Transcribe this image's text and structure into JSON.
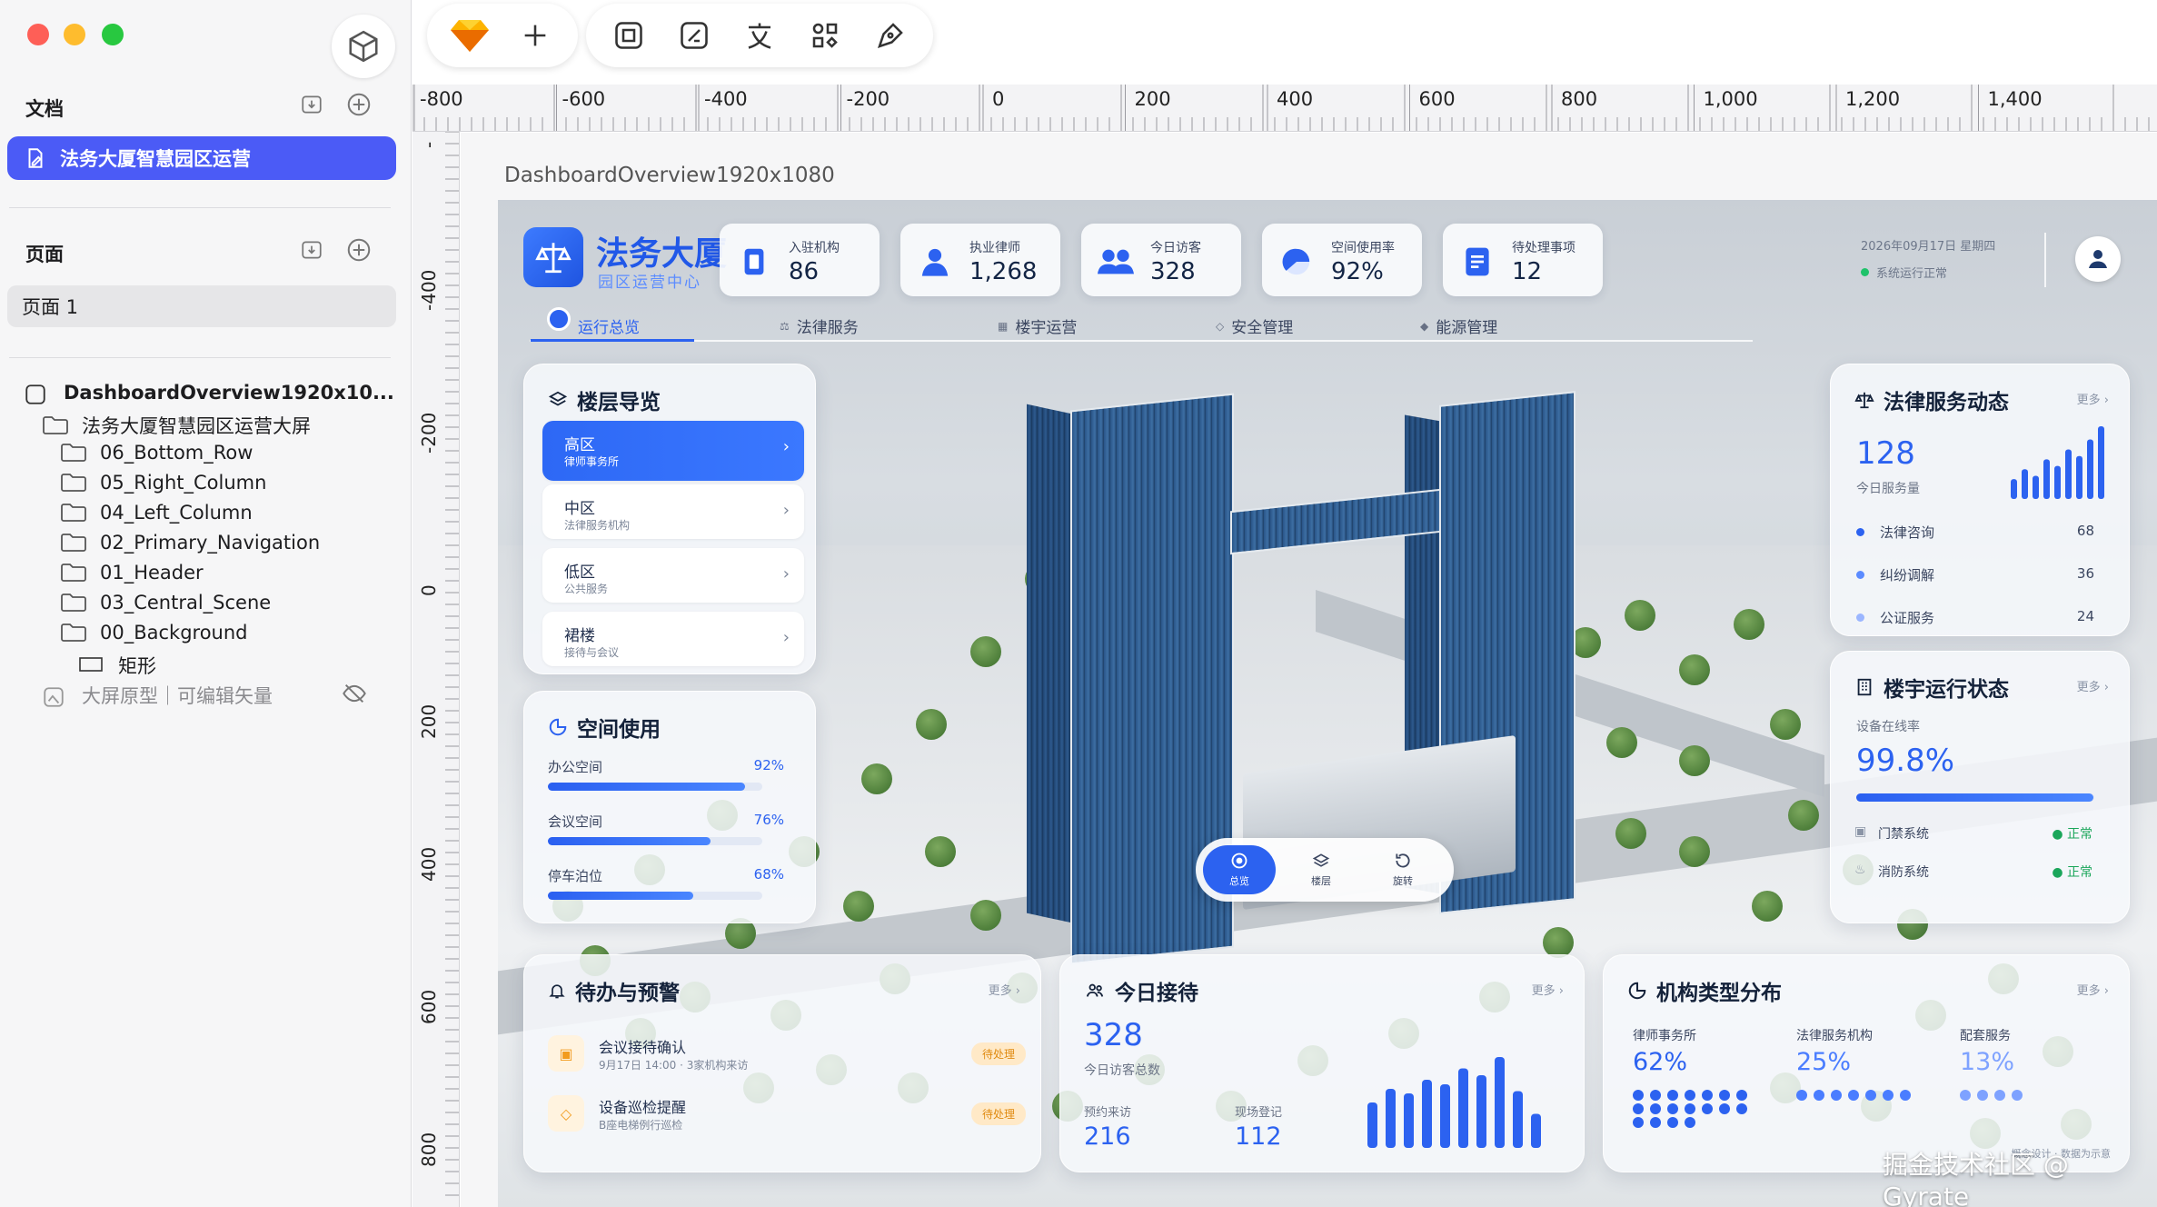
{
  "sidebar": {
    "docs_heading": "文档",
    "doc_name": "法务大厦智慧园区运营",
    "pages_heading": "页面",
    "page_name": "页面 1",
    "layers": [
      {
        "name": "DashboardOverview1920x10...",
        "kind": "frame",
        "indent": 0
      },
      {
        "name": "法务大厦智慧园区运营大屏",
        "kind": "folder",
        "indent": 1
      },
      {
        "name": "06_Bottom_Row",
        "kind": "folder",
        "indent": 2
      },
      {
        "name": "05_Right_Column",
        "kind": "folder",
        "indent": 2
      },
      {
        "name": "04_Left_Column",
        "kind": "folder",
        "indent": 2
      },
      {
        "name": "02_Primary_Navigation",
        "kind": "folder",
        "indent": 2
      },
      {
        "name": "01_Header",
        "kind": "folder",
        "indent": 2
      },
      {
        "name": "03_Central_Scene",
        "kind": "folder",
        "indent": 2
      },
      {
        "name": "00_Background",
        "kind": "folder",
        "indent": 2
      },
      {
        "name": "矩形",
        "kind": "rect",
        "indent": 3
      },
      {
        "name": "大屏原型｜可编辑矢量",
        "kind": "image-hidden",
        "indent": 1
      }
    ]
  },
  "toolbar": {
    "icons": [
      "sketch-gem-icon",
      "plus-icon",
      "frame-icon",
      "edit-shape-icon",
      "text-icon",
      "components-icon",
      "pen-icon"
    ]
  },
  "ruler": {
    "top_labels": [
      "-800",
      "-600",
      "-400",
      "-200",
      "0",
      "200",
      "400",
      "600",
      "800",
      "1,000",
      "1,200",
      "1,400"
    ],
    "left_labels": [
      "-",
      "-400",
      "-200",
      "0",
      "200",
      "400",
      "600",
      "800"
    ]
  },
  "canvas": {
    "frame_title": "DashboardOverview1920x1080"
  },
  "dashboard": {
    "brand": "法务大厦",
    "brand_sub": "园区运营中心",
    "kpis": [
      {
        "label": "入驻机构",
        "value": "86",
        "icon": "building-icon"
      },
      {
        "label": "执业律师",
        "value": "1,268",
        "icon": "person-icon"
      },
      {
        "label": "今日访客",
        "value": "328",
        "icon": "people-icon"
      },
      {
        "label": "空间使用率",
        "value": "92%",
        "icon": "pie-icon"
      },
      {
        "label": "待处理事项",
        "value": "12",
        "icon": "document-icon"
      }
    ],
    "date": "2026年09月17日 星期四",
    "status": "系统运行正常",
    "nav": [
      {
        "label": "运行总览",
        "active": true
      },
      {
        "label": "法律服务",
        "active": false
      },
      {
        "label": "楼宇运营",
        "active": false
      },
      {
        "label": "安全管理",
        "active": false
      },
      {
        "label": "能源管理",
        "active": false
      }
    ],
    "floors": {
      "title": "楼层导览",
      "items": [
        {
          "name": "高区",
          "desc": "律师事务所",
          "selected": true
        },
        {
          "name": "中区",
          "desc": "法律服务机构",
          "selected": false
        },
        {
          "name": "低区",
          "desc": "公共服务",
          "selected": false
        },
        {
          "name": "裙楼",
          "desc": "接待与会议",
          "selected": false
        }
      ]
    },
    "space": {
      "title": "空间使用",
      "rows": [
        {
          "label": "办公空间",
          "pct": "92%",
          "value": 0.92
        },
        {
          "label": "会议空间",
          "pct": "76%",
          "value": 0.76
        },
        {
          "label": "停车泊位",
          "pct": "68%",
          "value": 0.68
        }
      ]
    },
    "legal": {
      "title": "法律服务动态",
      "more": "更多 ›",
      "value": "128",
      "value_label": "今日服务量",
      "spark": [
        6,
        9,
        7,
        12,
        10,
        15,
        13,
        18,
        22
      ],
      "rows": [
        {
          "name": "法律咨询",
          "value": "68",
          "color": "#2c62f0"
        },
        {
          "name": "纠纷调解",
          "value": "36",
          "color": "#5b8bff"
        },
        {
          "name": "公证服务",
          "value": "24",
          "color": "#9bb6ff"
        }
      ]
    },
    "building": {
      "title": "楼宇运行状态",
      "more": "更多 ›",
      "label": "设备在线率",
      "value": "99.8%",
      "rate": 0.998,
      "systems": [
        {
          "name": "门禁系统",
          "status": "正常"
        },
        {
          "name": "消防系统",
          "status": "正常"
        }
      ]
    },
    "control": [
      {
        "label": "总览",
        "icon": "target-icon",
        "active": true
      },
      {
        "label": "楼层",
        "icon": "layers-icon",
        "active": false
      },
      {
        "label": "旋转",
        "icon": "rotate-icon",
        "active": false
      }
    ],
    "todo": {
      "title": "待办与预警",
      "more": "更多 ›",
      "items": [
        {
          "title": "会议接待确认",
          "desc": "9月17日 14:00 · 3家机构来访",
          "badge": "待处理"
        },
        {
          "title": "设备巡检提醒",
          "desc": "B座电梯例行巡检",
          "badge": "待处理"
        }
      ]
    },
    "reception": {
      "title": "今日接待",
      "more": "更多 ›",
      "value": "328",
      "value_label": "今日访客总数",
      "booked_label": "预约来访",
      "booked_value": "216",
      "walkin_label": "现场登记",
      "walkin_value": "112",
      "bars": [
        40,
        52,
        48,
        60,
        56,
        70,
        64,
        80,
        50,
        30
      ]
    },
    "orgs": {
      "title": "机构类型分布",
      "more": "更多 ›",
      "items": [
        {
          "label": "律师事务所",
          "value": "62%",
          "dots": 18,
          "color": "#2c62f0"
        },
        {
          "label": "法律服务机构",
          "value": "25%",
          "dots": 7,
          "color": "#4a7dff"
        },
        {
          "label": "配套服务",
          "value": "13%",
          "dots": 4,
          "color": "#7ea2ff"
        }
      ],
      "footnote": "概念设计 · 数据为示意"
    }
  },
  "watermark": "掘金技术社区 @ Gyrate"
}
